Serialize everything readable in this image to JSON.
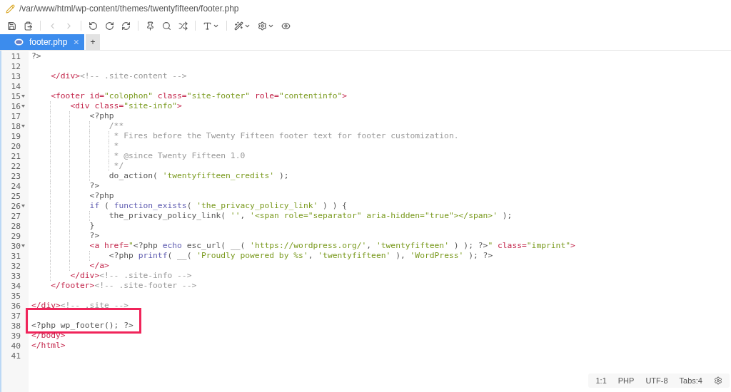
{
  "window": {
    "title": "/var/www/html/wp-content/themes/twentyfifteen/footer.php"
  },
  "toolbar": [
    {
      "kind": "save",
      "disabled": false
    },
    {
      "kind": "paste",
      "disabled": false
    },
    {
      "kind": "sep"
    },
    {
      "kind": "back",
      "disabled": true
    },
    {
      "kind": "forward",
      "disabled": true
    },
    {
      "kind": "sep"
    },
    {
      "kind": "undo",
      "disabled": false
    },
    {
      "kind": "redo",
      "disabled": false
    },
    {
      "kind": "reload",
      "disabled": false
    },
    {
      "kind": "sep"
    },
    {
      "kind": "pin",
      "disabled": false
    },
    {
      "kind": "search",
      "disabled": false
    },
    {
      "kind": "shuffle",
      "disabled": false
    },
    {
      "kind": "sep"
    },
    {
      "kind": "font",
      "disabled": false
    },
    {
      "kind": "sep"
    },
    {
      "kind": "wand",
      "disabled": false
    },
    {
      "kind": "settings",
      "disabled": false
    },
    {
      "kind": "preview",
      "disabled": false
    }
  ],
  "tabs": [
    {
      "label": "footer.php",
      "selected": true
    }
  ],
  "new_tab_button": "+",
  "code_lines": [
    {
      "number": "11",
      "foldable": false,
      "marked": false,
      "tokens": [
        {
          "kind": "plain",
          "text": "?>"
        }
      ]
    },
    {
      "number": "12",
      "foldable": false,
      "marked": false
    },
    {
      "number": "13",
      "foldable": false,
      "marked": false,
      "tokens": [
        {
          "kind": "tag",
          "text": "    </div>"
        },
        {
          "kind": "comment",
          "text": "<!-- .site-content -->"
        }
      ]
    },
    {
      "number": "14",
      "foldable": false,
      "marked": false
    },
    {
      "number": "15",
      "foldable": true,
      "marked": false,
      "tokens": [
        {
          "kind": "tag",
          "text": "    <footer id="
        },
        {
          "kind": "string",
          "text": "\"colophon\""
        },
        {
          "kind": "tag",
          "text": " class="
        },
        {
          "kind": "string",
          "text": "\"site-footer\""
        },
        {
          "kind": "tag",
          "text": " role="
        },
        {
          "kind": "string",
          "text": "\"contentinfo\""
        },
        {
          "kind": "tag",
          "text": ">"
        }
      ]
    },
    {
      "number": "16",
      "foldable": true,
      "marked": false,
      "tokens": [
        {
          "kind": "tag",
          "text": "        <div class="
        },
        {
          "kind": "string",
          "text": "\"site-info\""
        },
        {
          "kind": "tag",
          "text": ">"
        }
      ]
    },
    {
      "number": "17",
      "foldable": false,
      "marked": false,
      "tokens": [
        {
          "kind": "plain",
          "text": "            <?php"
        }
      ]
    },
    {
      "number": "18",
      "foldable": true,
      "marked": false,
      "tokens": [
        {
          "kind": "comment",
          "text": "                /**"
        }
      ]
    },
    {
      "number": "19",
      "foldable": false,
      "marked": false,
      "tokens": [
        {
          "kind": "comment",
          "text": "                 * Fires before the Twenty Fifteen footer text for footer customization."
        }
      ]
    },
    {
      "number": "20",
      "foldable": false,
      "marked": false,
      "tokens": [
        {
          "kind": "comment",
          "text": "                 *"
        }
      ]
    },
    {
      "number": "21",
      "foldable": false,
      "marked": false,
      "tokens": [
        {
          "kind": "comment",
          "text": "                 * @since Twenty Fifteen 1.0"
        }
      ]
    },
    {
      "number": "22",
      "foldable": false,
      "marked": false,
      "tokens": [
        {
          "kind": "comment",
          "text": "                 */"
        }
      ]
    },
    {
      "number": "23",
      "foldable": false,
      "marked": false,
      "tokens": [
        {
          "kind": "plain",
          "text": "                do_action( "
        },
        {
          "kind": "string",
          "text": "'twentyfifteen_credits'"
        },
        {
          "kind": "plain",
          "text": " );"
        }
      ]
    },
    {
      "number": "24",
      "foldable": false,
      "marked": false,
      "tokens": [
        {
          "kind": "plain",
          "text": "            ?>"
        }
      ]
    },
    {
      "number": "25",
      "foldable": false,
      "marked": false,
      "tokens": [
        {
          "kind": "plain",
          "text": "            <?php"
        }
      ]
    },
    {
      "number": "26",
      "foldable": true,
      "marked": false,
      "tokens": [
        {
          "kind": "keyword",
          "text": "            if"
        },
        {
          "kind": "plain",
          "text": " ( "
        },
        {
          "kind": "keyword",
          "text": "function_exists"
        },
        {
          "kind": "plain",
          "text": "( "
        },
        {
          "kind": "string",
          "text": "'the_privacy_policy_link'"
        },
        {
          "kind": "plain",
          "text": " ) ) {"
        }
      ]
    },
    {
      "number": "27",
      "foldable": false,
      "marked": false,
      "tokens": [
        {
          "kind": "plain",
          "text": "                the_privacy_policy_link( "
        },
        {
          "kind": "string",
          "text": "''"
        },
        {
          "kind": "plain",
          "text": ", "
        },
        {
          "kind": "string",
          "text": "'<span role=\"separator\" aria-hidden=\"true\"></span>'"
        },
        {
          "kind": "plain",
          "text": " );"
        }
      ]
    },
    {
      "number": "28",
      "foldable": false,
      "marked": false,
      "tokens": [
        {
          "kind": "plain",
          "text": "            }"
        }
      ]
    },
    {
      "number": "29",
      "foldable": false,
      "marked": false,
      "tokens": [
        {
          "kind": "plain",
          "text": "            ?>"
        }
      ]
    },
    {
      "number": "30",
      "foldable": true,
      "marked": false,
      "tokens": [
        {
          "kind": "tag",
          "text": "            <a href="
        },
        {
          "kind": "string",
          "text": "\""
        },
        {
          "kind": "plain",
          "text": "<?php "
        },
        {
          "kind": "keyword",
          "text": "echo"
        },
        {
          "kind": "plain",
          "text": " esc_url( __( "
        },
        {
          "kind": "string",
          "text": "'https://wordpress.org/'"
        },
        {
          "kind": "plain",
          "text": ", "
        },
        {
          "kind": "string",
          "text": "'twentyfifteen'"
        },
        {
          "kind": "plain",
          "text": " ) ); ?>"
        },
        {
          "kind": "string",
          "text": "\""
        },
        {
          "kind": "tag",
          "text": " class="
        },
        {
          "kind": "string",
          "text": "\"imprint\""
        },
        {
          "kind": "tag",
          "text": ">"
        }
      ]
    },
    {
      "number": "31",
      "foldable": false,
      "marked": false,
      "tokens": [
        {
          "kind": "plain",
          "text": "                <?php "
        },
        {
          "kind": "keyword",
          "text": "printf"
        },
        {
          "kind": "plain",
          "text": "( __( "
        },
        {
          "kind": "string",
          "text": "'Proudly powered by %s'"
        },
        {
          "kind": "plain",
          "text": ", "
        },
        {
          "kind": "string",
          "text": "'twentyfifteen'"
        },
        {
          "kind": "plain",
          "text": " ), "
        },
        {
          "kind": "string",
          "text": "'WordPress'"
        },
        {
          "kind": "plain",
          "text": " ); ?>"
        }
      ]
    },
    {
      "number": "32",
      "foldable": false,
      "marked": false,
      "tokens": [
        {
          "kind": "tag",
          "text": "            </a>"
        }
      ]
    },
    {
      "number": "33",
      "foldable": false,
      "marked": false,
      "tokens": [
        {
          "kind": "tag",
          "text": "        </div>"
        },
        {
          "kind": "comment",
          "text": "<!-- .site-info -->"
        }
      ]
    },
    {
      "number": "34",
      "foldable": false,
      "marked": false,
      "tokens": [
        {
          "kind": "tag",
          "text": "    </footer>"
        },
        {
          "kind": "comment",
          "text": "<!-- .site-footer -->"
        }
      ]
    },
    {
      "number": "35",
      "foldable": false,
      "marked": false
    },
    {
      "number": "36",
      "foldable": false,
      "marked": false,
      "tokens": [
        {
          "kind": "tag",
          "text": "</div>"
        },
        {
          "kind": "comment",
          "text": "<!-- .site -->"
        }
      ]
    },
    {
      "number": "37",
      "foldable": false,
      "marked": true
    },
    {
      "number": "38",
      "foldable": false,
      "marked": true,
      "tokens": [
        {
          "kind": "plain",
          "text": "<?php wp_footer(); ?>"
        }
      ]
    },
    {
      "number": "39",
      "foldable": false,
      "marked": false,
      "tokens": [
        {
          "kind": "tag",
          "text": "</body>"
        }
      ]
    },
    {
      "number": "40",
      "foldable": false,
      "marked": false,
      "tokens": [
        {
          "kind": "tag",
          "text": "</html>"
        }
      ]
    },
    {
      "number": "41",
      "foldable": false,
      "marked": false
    }
  ],
  "status_bar": [
    "1:1",
    "PHP",
    "UTF-8",
    "Tabs:4"
  ]
}
